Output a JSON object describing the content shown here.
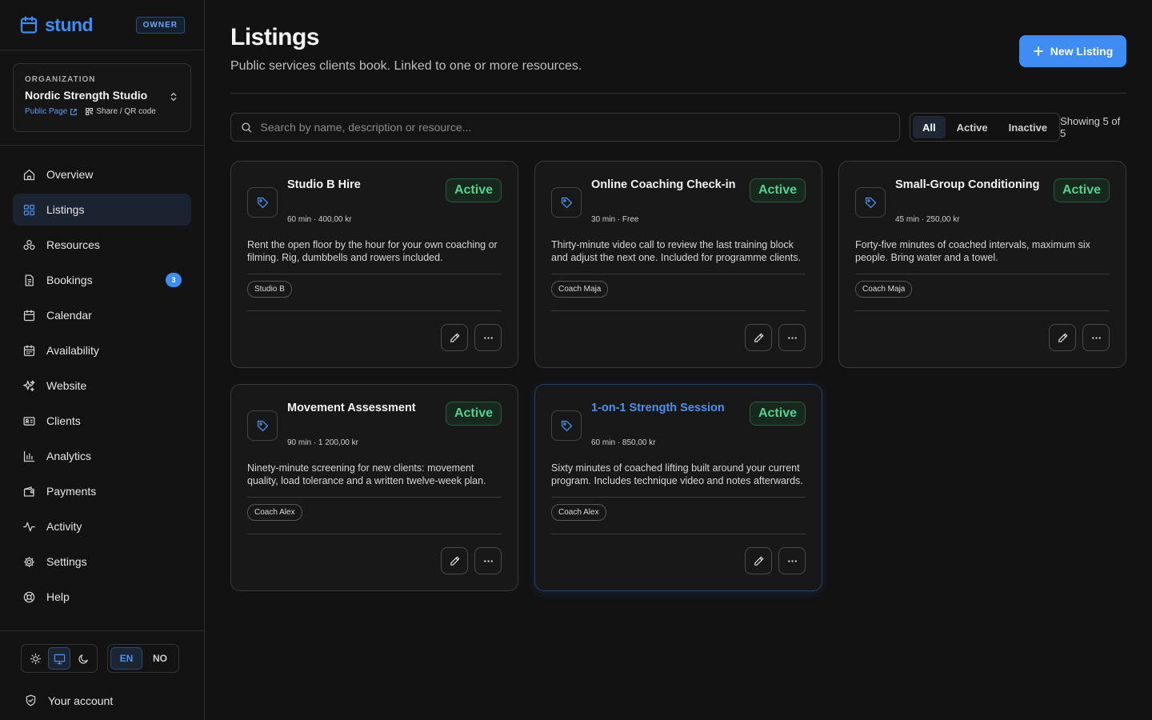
{
  "brand": {
    "name": "stund",
    "role_badge": "OWNER"
  },
  "organization": {
    "label": "ORGANIZATION",
    "name": "Nordic Strength Studio",
    "public_page": "Public Page",
    "share": "Share / QR code"
  },
  "nav": [
    {
      "label": "Overview",
      "icon": "home-icon"
    },
    {
      "label": "Listings",
      "icon": "grid-icon",
      "active": true
    },
    {
      "label": "Resources",
      "icon": "resources-icon"
    },
    {
      "label": "Bookings",
      "icon": "document-icon",
      "count": "3"
    },
    {
      "label": "Calendar",
      "icon": "calendar-icon"
    },
    {
      "label": "Availability",
      "icon": "calendar-grid-icon"
    },
    {
      "label": "Website",
      "icon": "sparkles-icon"
    },
    {
      "label": "Clients",
      "icon": "id-card-icon"
    },
    {
      "label": "Analytics",
      "icon": "bar-chart-icon"
    },
    {
      "label": "Payments",
      "icon": "wallet-icon"
    },
    {
      "label": "Activity",
      "icon": "pulse-icon"
    },
    {
      "label": "Settings",
      "icon": "gear-icon"
    },
    {
      "label": "Help",
      "icon": "lifebuoy-icon"
    }
  ],
  "theme": {
    "options": [
      "light",
      "system",
      "dark"
    ],
    "selected": "system"
  },
  "language": {
    "options": [
      "EN",
      "NO"
    ],
    "selected": "EN"
  },
  "account": {
    "label": "Your account"
  },
  "header": {
    "title": "Listings",
    "subtitle": "Public services clients book. Linked to one or more resources.",
    "new_button": "New Listing"
  },
  "search": {
    "placeholder": "Search by name, description or resource..."
  },
  "filters": {
    "options": [
      "All",
      "Active",
      "Inactive"
    ],
    "selected": "All"
  },
  "showing": "Showing 5 of 5",
  "listings": [
    {
      "title": "Studio B Hire",
      "status": "Active",
      "meta": "60 min · 400,00 kr",
      "description": "Rent the open floor by the hour for your own coaching or filming. Rig, dumbbells and rowers included.",
      "resource": "Studio B"
    },
    {
      "title": "Online Coaching Check-in",
      "status": "Active",
      "meta": "30 min · Free",
      "description": "Thirty-minute video call to review the last training block and adjust the next one. Included for programme clients.",
      "resource": "Coach Maja"
    },
    {
      "title": "Small-Group Conditioning",
      "status": "Active",
      "meta": "45 min · 250,00 kr",
      "description": "Forty-five minutes of coached intervals, maximum six people. Bring water and a towel.",
      "resource": "Coach Maja"
    },
    {
      "title": "Movement Assessment",
      "status": "Active",
      "meta": "90 min · 1 200,00 kr",
      "description": "Ninety-minute screening for new clients: movement quality, load tolerance and a written twelve-week plan.",
      "resource": "Coach Alex"
    },
    {
      "title": "1-on-1 Strength Session",
      "status": "Active",
      "meta": "60 min · 850,00 kr",
      "description": "Sixty minutes of coached lifting built around your current program. Includes technique video and notes afterwards.",
      "resource": "Coach Alex",
      "highlighted": true
    }
  ],
  "colors": {
    "accent": "#3d8df5",
    "status_active": "#56d08b",
    "background": "#121212"
  }
}
